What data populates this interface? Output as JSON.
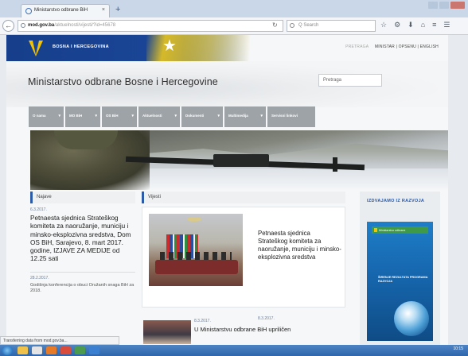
{
  "browser": {
    "tab_title": "Ministarstvo odbrane BiH",
    "tab_close": "×",
    "new_tab": "+",
    "back": "←",
    "url_domain": "mod.gov.ba",
    "url_rest": "/aktuelnosti/vijesti/?id=45678",
    "reload": "↻",
    "search_placeholder": "Q Search",
    "toolbar_icons": [
      "☆",
      "⚙",
      "⬇",
      "⌂",
      "≡",
      "☰"
    ]
  },
  "site": {
    "country_name": "BOSNA I HERCEGOVINA",
    "title": "Ministarstvo odbrane Bosne i Hercegovine",
    "search_placeholder": "Pretraga",
    "top_links": "MINISTAR | OPSENU | ENGLISH",
    "top_links_muted": "PRETRAGA"
  },
  "menu": [
    {
      "label": "O nama",
      "width": 44
    },
    {
      "label": "MO BiH",
      "width": 44
    },
    {
      "label": "OS BiH",
      "width": 44
    },
    {
      "label": "Aktuelnosti",
      "width": 52
    },
    {
      "label": "Dokumenti",
      "width": 52
    },
    {
      "label": "Multimedija",
      "width": 52
    },
    {
      "label": "Servisni linkovi",
      "width": 60
    }
  ],
  "news": {
    "header": "Najave",
    "date": "6.3.2017.",
    "title": "Petnaesta sjednica Strateškog komiteta za naoružanje, municiju i minsko-eksplozivna sredstva, Dom OS BiH, Sarajevo, 8. mart 2017. godine, IZJAVE ZA MEDIJE od 12.25 sati",
    "date2": "28.2.2017.",
    "title2": "Godišnja konferencija o obuci Oružanih snaga BiH za 2018."
  },
  "announcements": {
    "header": "Vijesti",
    "title": "Petnaesta sjednica Strateškog komiteta za naoružanje, municiju i minsko-eksplozivna sredstva",
    "date": "8.3.2017.",
    "date2": "8.3.2017.",
    "title2": "U Ministarstvu odbrane BiH upriličen"
  },
  "sidebar": {
    "heading": "IZDVAJAMO IZ RAZVOJA",
    "cover_head": "Ministarstvo odbrane",
    "cover_title": "ŠIRENJE REZULTATA PROGRAMA RAZVOJA"
  },
  "status": {
    "text": "Transferring data from mod.gov.ba..."
  },
  "taskbar": {
    "clock": "10:15"
  },
  "colors": {
    "brand_blue": "#1a4596",
    "flag_yellow": "#f6cd16",
    "menu_gray": "#9ea3a8",
    "accent_blue": "#2b5aa6"
  }
}
